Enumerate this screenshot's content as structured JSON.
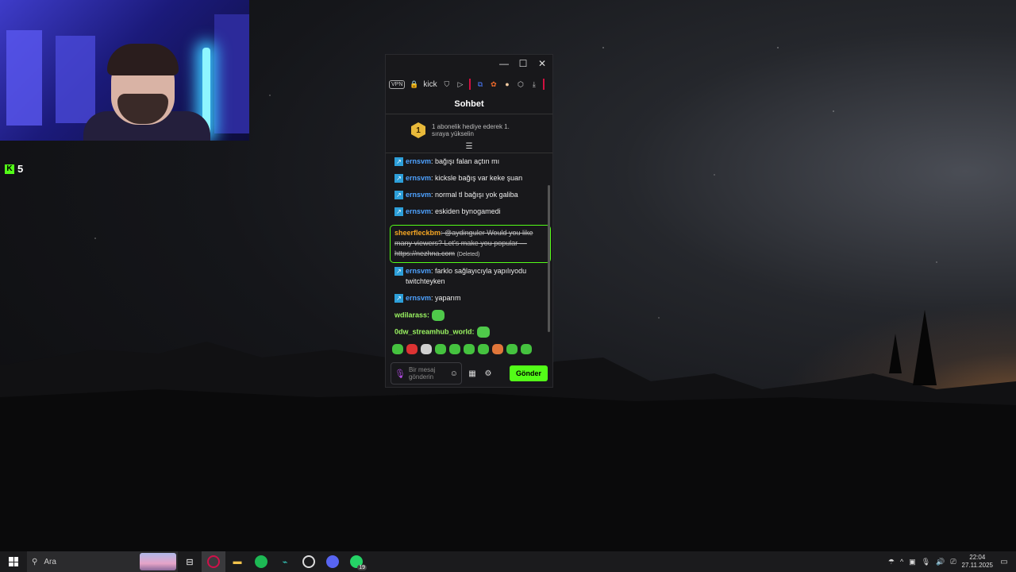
{
  "desktop": {
    "kick_viewer_count": "5"
  },
  "chat_window": {
    "titlebar": {
      "minimize": "—",
      "maximize": "☐",
      "close": "✕"
    },
    "toolbar": {
      "vpn_label": "VPN",
      "url_text": "kick"
    },
    "title": "Sohbet",
    "gift_banner": {
      "rank": "1",
      "text": "1 abonelik hediye ederek 1. sıraya yükselin"
    },
    "messages": [
      {
        "user": "ernsvm",
        "text": ": bağışı falan açtın mı"
      },
      {
        "user": "ernsvm",
        "text": ": kicksle bağış var keke şuan"
      },
      {
        "user": "ernsvm",
        "text": ": normal tl bağışı yok galiba"
      },
      {
        "user": "ernsvm",
        "text": ": eskiden bynogamedi"
      },
      {
        "user": "ernsvm",
        "text": ": farklo sağlayıcıyla yapılıyodu twitchteyken"
      },
      {
        "user": "ernsvm",
        "text": ": yaparım"
      }
    ],
    "flagged_message": {
      "user": "sheerfleckbm",
      "text": ": @aydinguler Would you like many viewers? Let's make you popular — https://nezhna.com",
      "deleted_label": "(Deleted)"
    },
    "emote_messages": [
      {
        "user": "wdilarass:"
      },
      {
        "user": "0dw_streamhub_world:"
      }
    ],
    "input": {
      "placeholder": "Bir mesaj gönderin"
    },
    "send_label": "Gönder"
  },
  "taskbar": {
    "search_placeholder": "Ara",
    "whatsapp_count": "19",
    "time": "22:04",
    "date": "27.11.2025"
  },
  "colors": {
    "kick_green": "#53fc18",
    "username_blue": "#4ea2ff",
    "taskbar_bg": "#1b1b1d"
  }
}
